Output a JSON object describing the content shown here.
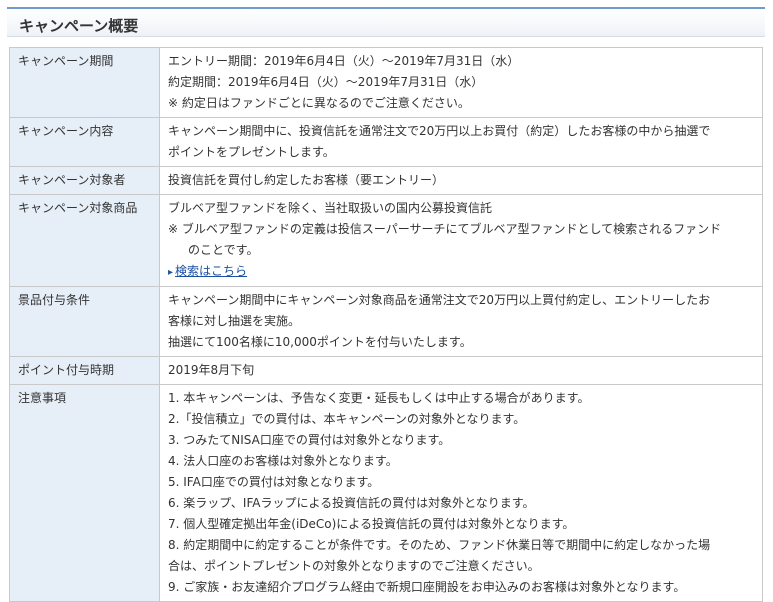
{
  "header": {
    "title": "キャンペーン概要"
  },
  "rows": {
    "period": {
      "label": "キャンペーン期間",
      "lines": [
        "エントリー期間：2019年6月4日（火）～2019年7月31日（水）",
        "約定期間：2019年6月4日（火）～2019年7月31日（水）",
        "※ 約定日はファンドごとに異なるのでご注意ください。"
      ]
    },
    "content": {
      "label": "キャンペーン内容",
      "lines": [
        "キャンペーン期間中に、投資信託を通常注文で20万円以上お買付（約定）したお客様の中から抽選で",
        "ポイントをプレゼントします。"
      ]
    },
    "target": {
      "label": "キャンペーン対象者",
      "lines": [
        "投資信託を買付し約定したお客様（要エントリー）"
      ]
    },
    "products": {
      "label": "キャンペーン対象商品",
      "lines": [
        "ブルベア型ファンドを除く、当社取扱いの国内公募投資信託",
        "※ ブルベア型ファンドの定義は投信スーパーサーチにてブルベア型ファンドとして検索されるファンド",
        "のことです。"
      ],
      "link_label": "検索はこちら"
    },
    "conditions": {
      "label": "景品付与条件",
      "lines": [
        "キャンペーン期間中にキャンペーン対象商品を通常注文で20万円以上買付約定し、エントリーしたお",
        "客様に対し抽選を実施。",
        "抽選にて100名様に10,000ポイントを付与いたします。"
      ]
    },
    "timing": {
      "label": "ポイント付与時期",
      "lines": [
        "2019年8月下旬"
      ]
    },
    "notes": {
      "label": "注意事項",
      "lines": [
        "1. 本キャンペーンは、予告なく変更・延長もしくは中止する場合があります。",
        "2.「投信積立」での買付は、本キャンペーンの対象外となります。",
        "3. つみたてNISA口座での買付は対象外となります。",
        "4. 法人口座のお客様は対象外となります。",
        "5. IFA口座での買付は対象となります。",
        "6. 楽ラップ、IFAラップによる投資信託の買付は対象外となります。",
        "7. 個人型確定拠出年金(iDeCo)による投資信託の買付は対象外となります。",
        "8. 約定期間中に約定することが条件です。そのため、ファンド休業日等で期間中に約定しなかった場",
        "合は、ポイントプレゼントの対象外となりますのでご注意ください。",
        "9. ご家族・お友達紹介プログラム経由で新規口座開設をお申込みのお客様は対象外となります。"
      ]
    }
  }
}
